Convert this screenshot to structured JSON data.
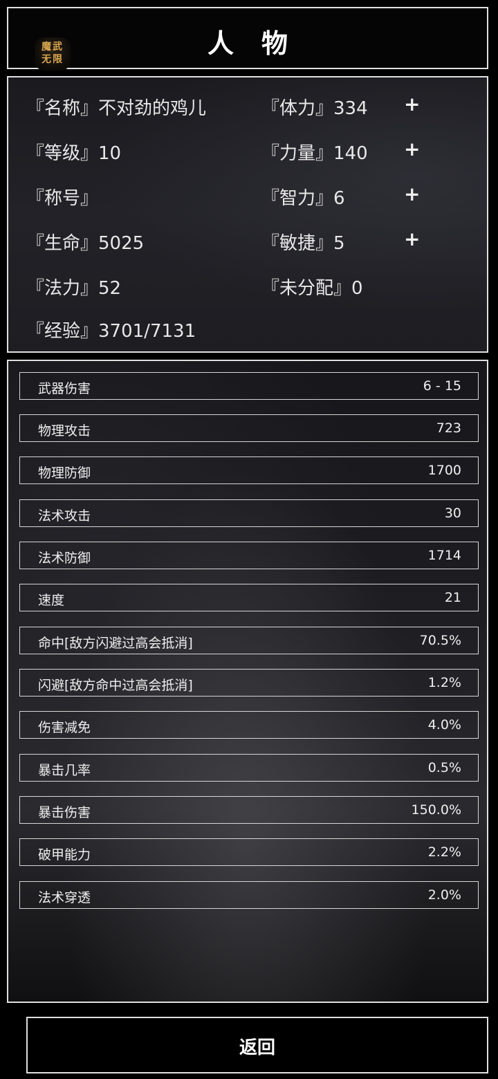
{
  "header": {
    "title": "人物",
    "logo_text": [
      "魔武",
      "无限"
    ]
  },
  "character": {
    "left": [
      {
        "label": "『名称』",
        "value": "不对劲的鸡儿"
      },
      {
        "label": "『等级』",
        "value": "10"
      },
      {
        "label": "『称号』",
        "value": ""
      },
      {
        "label": "『生命』",
        "value": "5025"
      },
      {
        "label": "『法力』",
        "value": "52"
      },
      {
        "label": "『经验』",
        "value": "3701/7131"
      }
    ],
    "right": [
      {
        "label": "『体力』",
        "value": "334",
        "plus": "+"
      },
      {
        "label": "『力量』",
        "value": "140",
        "plus": "+"
      },
      {
        "label": "『智力』",
        "value": "6",
        "plus": "+"
      },
      {
        "label": "『敏捷』",
        "value": "5",
        "plus": "+"
      },
      {
        "label": "『未分配』",
        "value": "0"
      }
    ]
  },
  "stats": [
    {
      "label": "武器伤害",
      "value": "6 - 15"
    },
    {
      "label": "物理攻击",
      "value": "723"
    },
    {
      "label": "物理防御",
      "value": "1700"
    },
    {
      "label": "法术攻击",
      "value": "30"
    },
    {
      "label": "法术防御",
      "value": "1714"
    },
    {
      "label": "速度",
      "value": "21"
    },
    {
      "label": "命中[敌方闪避过高会抵消]",
      "value": "70.5%"
    },
    {
      "label": "闪避[敌方命中过高会抵消]",
      "value": "1.2%"
    },
    {
      "label": "伤害减免",
      "value": "4.0%"
    },
    {
      "label": "暴击几率",
      "value": "0.5%"
    },
    {
      "label": "暴击伤害",
      "value": "150.0%"
    },
    {
      "label": "破甲能力",
      "value": "2.2%"
    },
    {
      "label": "法术穿透",
      "value": "2.0%"
    }
  ],
  "footer": {
    "back_label": "返回"
  },
  "colors": {
    "border": "#e0e0e0",
    "text": "#e8e8e8",
    "logo_gold": "#d9a84e"
  }
}
